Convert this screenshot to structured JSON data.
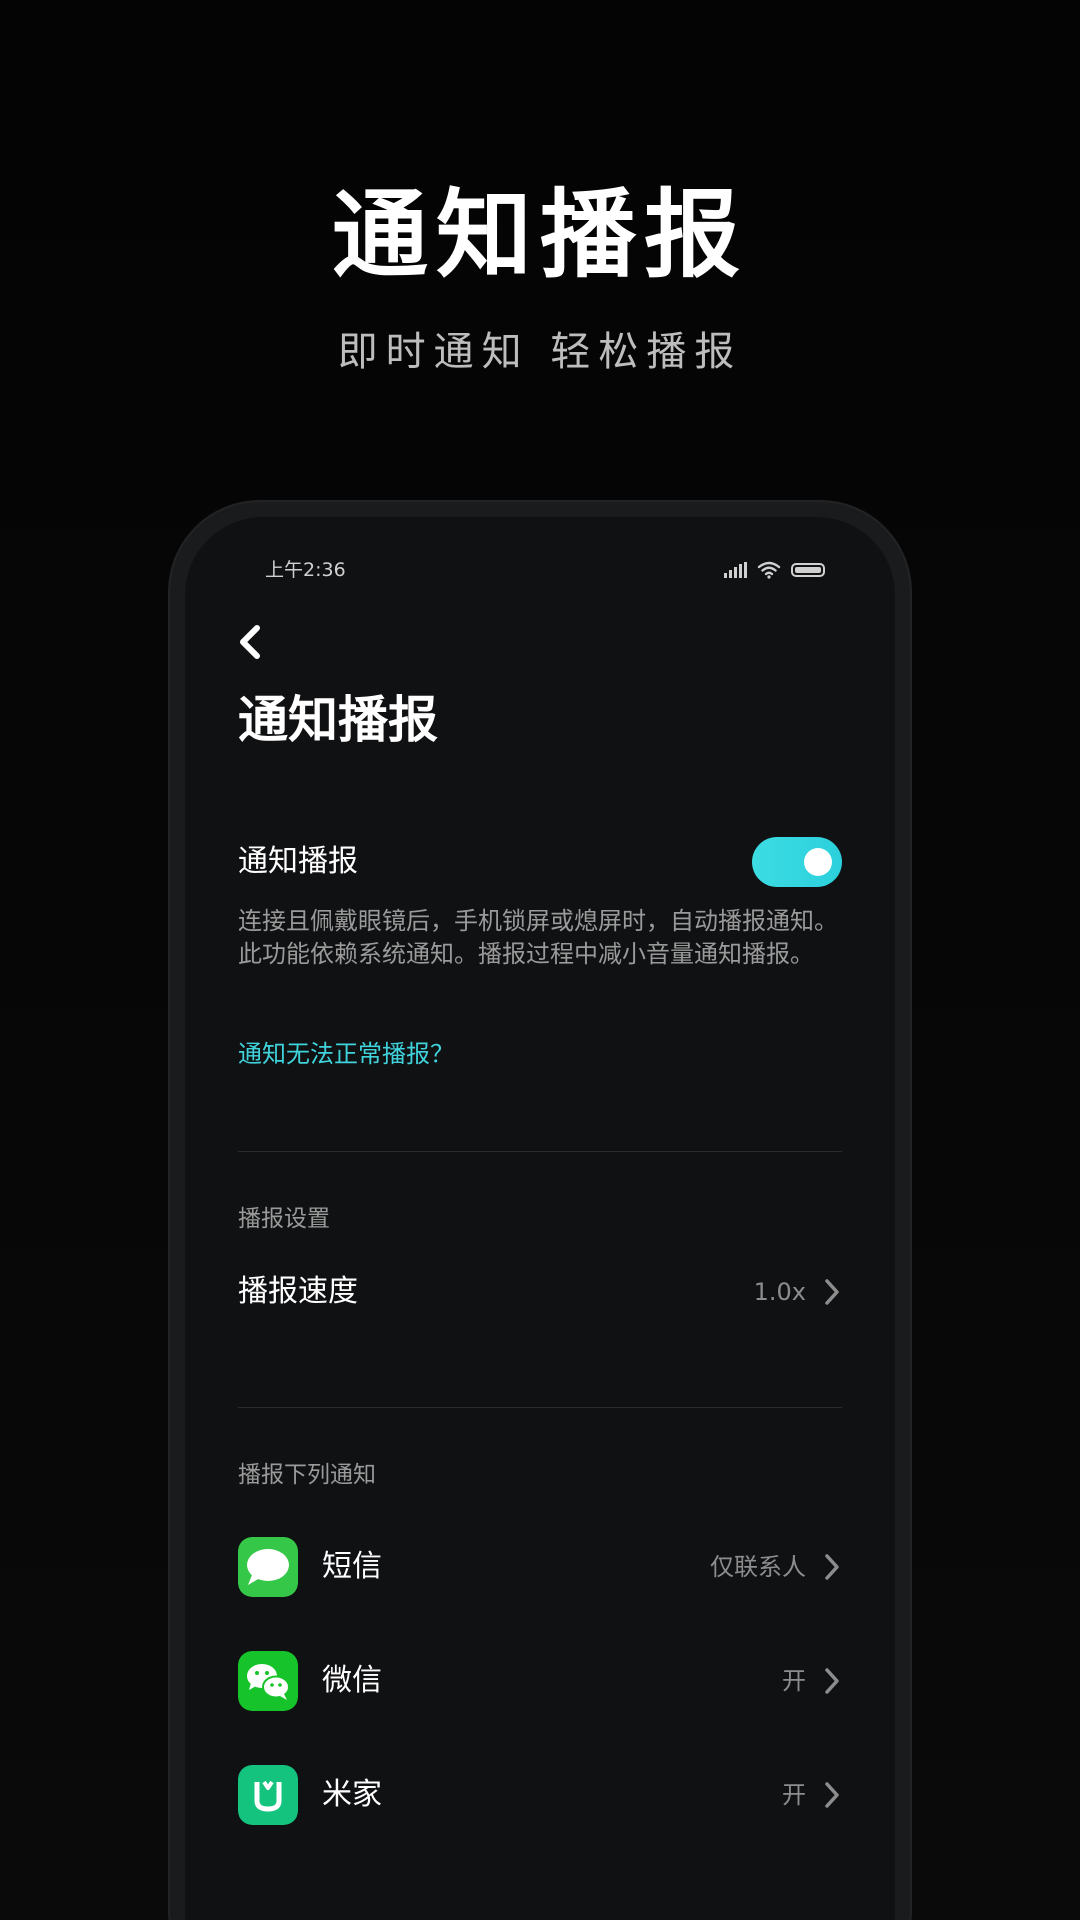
{
  "hero": {
    "title": "通知播报",
    "subtitle": "即时通知 轻松播报"
  },
  "status_bar": {
    "time": "上午2:36",
    "icons": [
      "signal-icon",
      "wifi-icon",
      "battery-icon"
    ]
  },
  "screen": {
    "title": "通知播报",
    "back_icon": "back-arrow-icon"
  },
  "toggle_row": {
    "label": "通知播报",
    "enabled": true,
    "accent_color": "#3ddce3"
  },
  "description": "连接且佩戴眼镜后，手机锁屏或熄屏时，自动播报通知。此功能依赖系统通知。播报过程中减小音量通知播报。",
  "help_link": "通知无法正常播报？",
  "broadcast_settings": {
    "header": "播报设置",
    "speed_label": "播报速度",
    "speed_value": "1.0x"
  },
  "notify_list": {
    "header": "播报下列通知",
    "apps": [
      {
        "name": "短信",
        "value": "仅联系人",
        "icon": "sms-icon",
        "color": "#35c748"
      },
      {
        "name": "微信",
        "value": "开",
        "icon": "wechat-icon",
        "color": "#17c32b"
      },
      {
        "name": "米家",
        "value": "开",
        "icon": "mijia-icon",
        "color": "#14c47e"
      }
    ]
  }
}
